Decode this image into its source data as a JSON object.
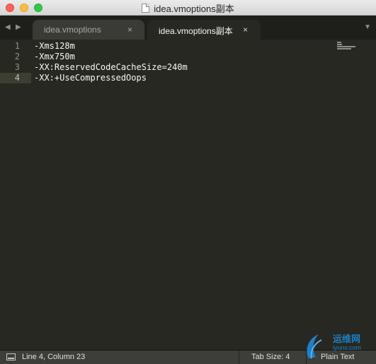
{
  "window": {
    "title": "idea.vmoptions副本"
  },
  "tabs": [
    {
      "label": "idea.vmoptions",
      "active": false
    },
    {
      "label": "idea.vmoptions副本",
      "active": true
    }
  ],
  "tab_close_glyph": "×",
  "nav": {
    "back_glyph": "◀",
    "forward_glyph": "▶",
    "menu_glyph": "▼"
  },
  "editor": {
    "lines": [
      {
        "number": "1",
        "text": "-Xms128m"
      },
      {
        "number": "2",
        "text": "-Xmx750m"
      },
      {
        "number": "3",
        "text": "-XX:ReservedCodeCacheSize=240m"
      },
      {
        "number": "4",
        "text": "-XX:+UseCompressedOops"
      }
    ],
    "current_line": 4
  },
  "statusbar": {
    "position": "Line 4, Column 23",
    "tab_size": "Tab Size: 4",
    "syntax": "Plain Text"
  },
  "watermark": {
    "text": "运维网",
    "sub": "iyunv.com"
  },
  "colors": {
    "editor_bg": "#272822",
    "text": "#f8f8f2",
    "gutter": "#8f908a",
    "current_line": "#3e3d32",
    "watermark": "#1d7fc6"
  }
}
